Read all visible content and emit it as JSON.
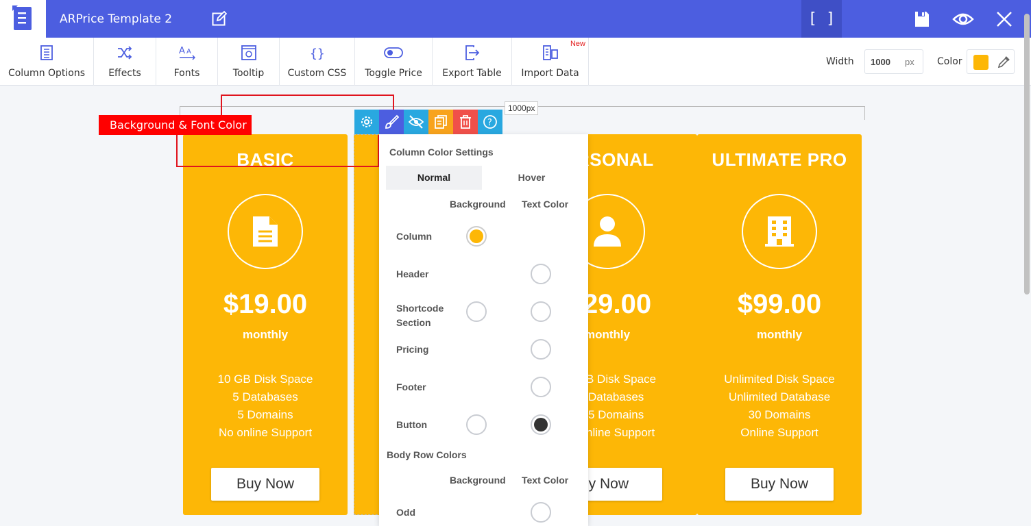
{
  "app": {
    "title": "ARPrice Template 2",
    "fullscreen_label": "[ ]"
  },
  "toolbar": {
    "items": [
      {
        "label": "Column Options",
        "icon": "column-options-icon"
      },
      {
        "label": "Effects",
        "icon": "shuffle-icon"
      },
      {
        "label": "Fonts",
        "icon": "font-icon"
      },
      {
        "label": "Tooltip",
        "icon": "tooltip-icon"
      },
      {
        "label": "Custom CSS",
        "icon": "braces-icon"
      },
      {
        "label": "Toggle Price",
        "icon": "toggle-icon"
      },
      {
        "label": "Export Table",
        "icon": "export-icon"
      },
      {
        "label": "Import Data",
        "icon": "import-icon"
      }
    ],
    "new_badge": "New",
    "width_label": "Width",
    "width_value": "1000",
    "width_unit": "px",
    "color_label": "Color",
    "color_value": "#fdb706"
  },
  "canvas": {
    "width_label": "1000px",
    "annotation": "Background & Font Color"
  },
  "columns": [
    {
      "title": "BASIC",
      "price": "$19.00",
      "period": "monthly",
      "features": [
        "10 GB Disk Space",
        "5 Databases",
        "5 Domains",
        "No online Support"
      ],
      "button": "Buy Now",
      "icon": "document-icon"
    },
    {
      "title": "RSONAL",
      "price": "29.00",
      "period": "monthly",
      "features": [
        "B Disk Space",
        "Databases",
        "5 Domains",
        "nline Support"
      ],
      "button": "uy Now",
      "icon": "user-icon"
    },
    {
      "title": "ULTIMATE PRO",
      "price": "$99.00",
      "period": "monthly",
      "features": [
        "Unlimited Disk Space",
        "Unlimited Database",
        "30 Domains",
        "Online Support"
      ],
      "button": "Buy Now",
      "icon": "building-icon"
    }
  ],
  "panel": {
    "heading": "Column Color Settings",
    "tabs": [
      "Normal",
      "Hover"
    ],
    "col_background": "Background",
    "col_text": "Text Color",
    "rows": [
      "Column",
      "Header",
      "Shortcode Section",
      "Pricing",
      "Footer",
      "Button"
    ],
    "body_heading": "Body Row Colors",
    "body_rows": [
      "Odd"
    ]
  },
  "colors": {
    "accent": "#4c5ee0",
    "column": "#fdb706",
    "annotation": "#ff0000"
  }
}
